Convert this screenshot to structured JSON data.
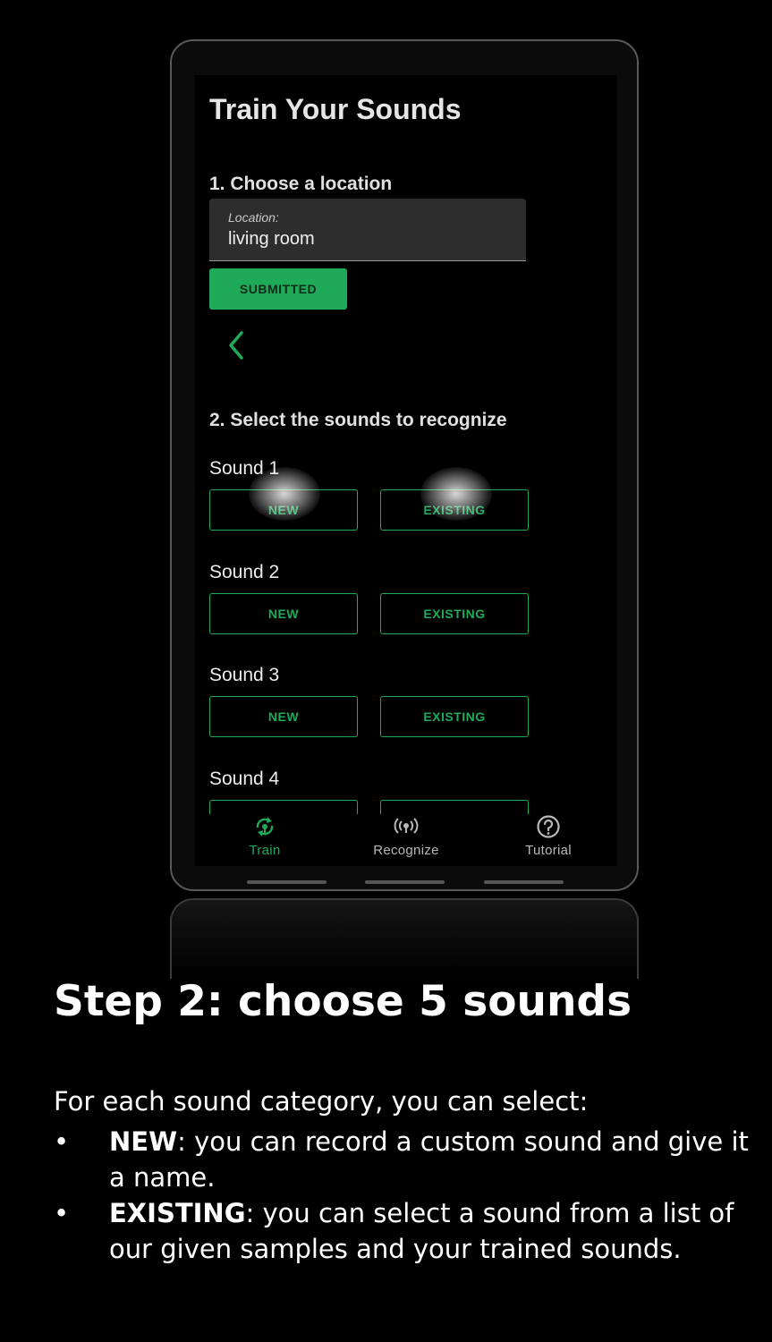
{
  "app": {
    "title": "Train Your Sounds",
    "section1": "1. Choose a location",
    "location_label": "Location:",
    "location_value": "living room",
    "submit_label": "SUBMITTED",
    "section2": "2. Select the sounds to recognize",
    "sounds": [
      {
        "label": "Sound 1",
        "new": "NEW",
        "existing": "EXISTING"
      },
      {
        "label": "Sound 2",
        "new": "NEW",
        "existing": "EXISTING"
      },
      {
        "label": "Sound 3",
        "new": "NEW",
        "existing": "EXISTING"
      },
      {
        "label": "Sound 4"
      }
    ],
    "nav": [
      {
        "label": "Train",
        "icon": "train-icon",
        "active": true
      },
      {
        "label": "Recognize",
        "icon": "recognize-icon",
        "active": false
      },
      {
        "label": "Tutorial",
        "icon": "help-circle-icon",
        "active": false
      }
    ]
  },
  "caption": {
    "title": "Step 2: choose 5 sounds",
    "intro": "For each sound category, you can select:",
    "bullet_symbol": "•",
    "items": [
      {
        "term": "NEW",
        "text": ": you can record a custom sound and give it a name."
      },
      {
        "term": "EXISTING",
        "text": ": you can select a sound from a list of our given samples and your trained sounds."
      }
    ]
  },
  "colors": {
    "accent": "#1faa59",
    "background": "#000000",
    "field": "#2d2d2d",
    "nav_inactive": "#b8b8b8"
  }
}
